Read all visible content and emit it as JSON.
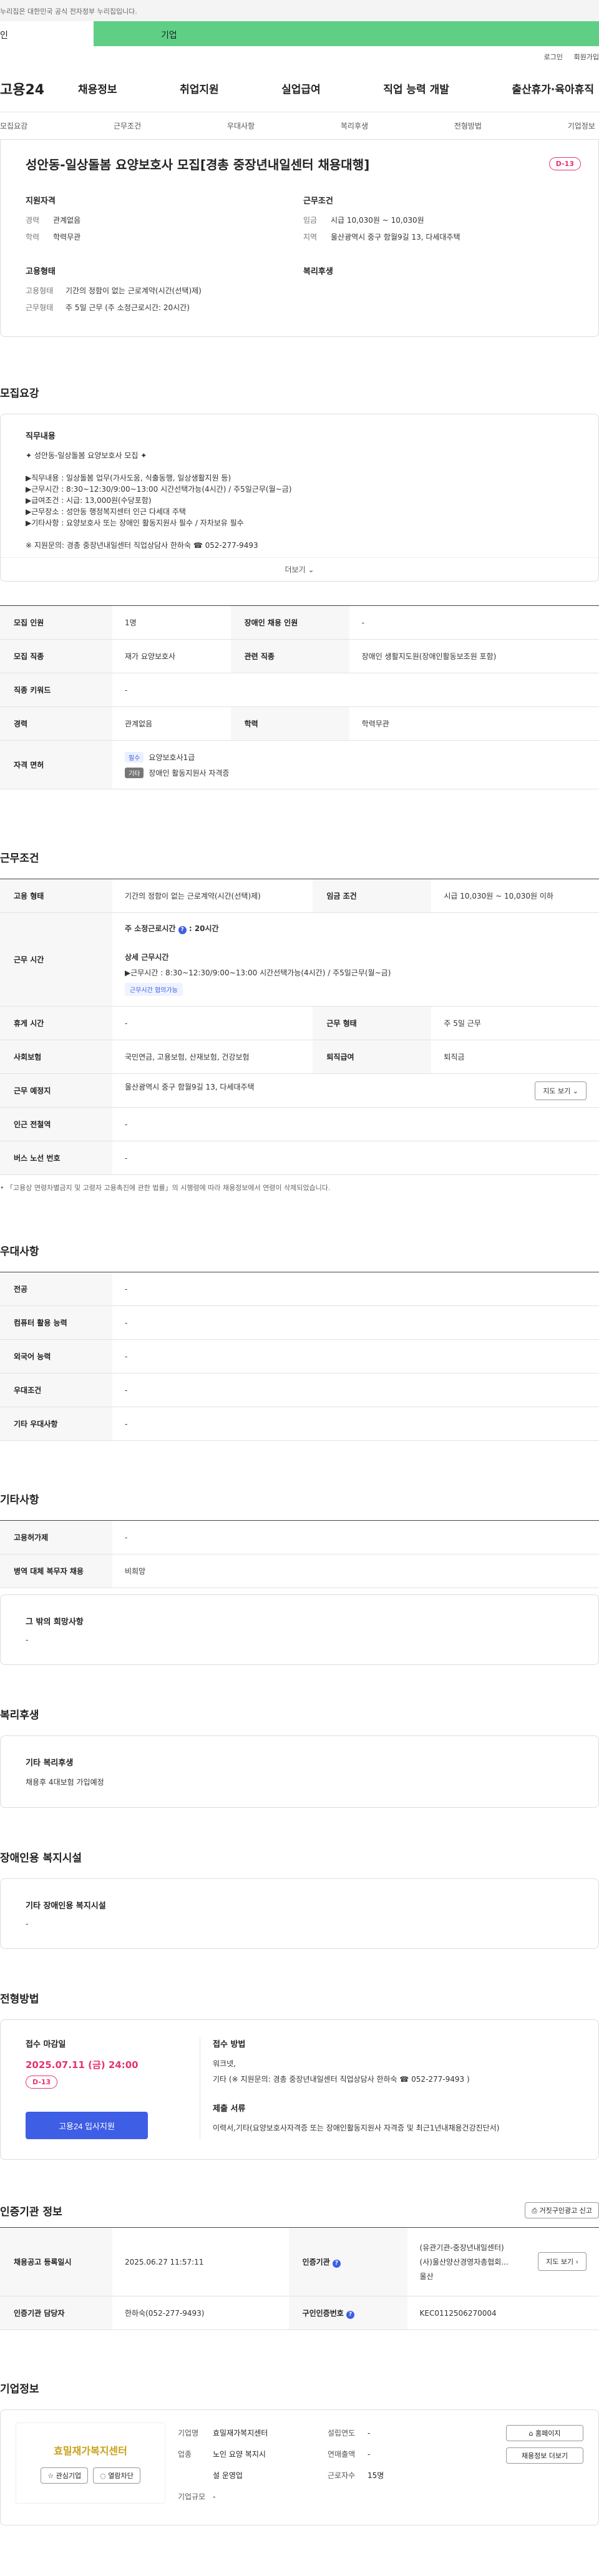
{
  "gov_notice": "누리집은 대한민국 공식 전자정부 누리집입니다.",
  "tabs": {
    "personal": "인",
    "business": "기업"
  },
  "utility": {
    "login": "로그인",
    "join": "회원가입"
  },
  "gnb": {
    "logo": "고용24",
    "menu": [
      "채용정보",
      "취업지원",
      "실업급여",
      "직업 능력 개발",
      "출산휴가·육아휴직"
    ]
  },
  "anchors": [
    "모집요강",
    "근무조건",
    "우대사항",
    "복리후생",
    "전형방법",
    "기업정보"
  ],
  "summary": {
    "title": "성안동-일상돌봄 요양보호사 모집[경총 중장년내일센터 채용대행]",
    "dday": "D-13",
    "qual": {
      "heading": "지원자격",
      "career_k": "경력",
      "career_v": "관계없음",
      "edu_k": "학력",
      "edu_v": "학력무관"
    },
    "cond": {
      "heading": "근무조건",
      "wage_k": "임금",
      "wage_v": "시급 10,030원 ~ 10,030원",
      "area_k": "지역",
      "area_v": "울산광역시 중구 함월9길 13, 다세대주택"
    },
    "emp": {
      "heading": "고용형태",
      "type_k": "고용형태",
      "type_v": "기간의 정함이 없는 근로계약(시간(선택)제)",
      "work_k": "근무형태",
      "work_v": "주 5일 근무 (주 소정근로시간: 20시간)"
    },
    "welfare": {
      "heading": "복리후생"
    }
  },
  "recruit": {
    "section_title": "모집요강",
    "desc_heading": "직무내용",
    "desc_lines": [
      "✦ 성안동-일상돌봄 요양보호사 모집 ✦",
      "",
      "▶직무내용 : 일상돌봄 업무(가사도움, 식출동행, 일상생활지원 등)",
      "▶근무시간 : 8:30~12:30/9:00~13:00 시간선택가능(4시간) / 주5일근무(월~금)",
      "▶급여조건 : 시급: 13,000원(수당포함)",
      "▶근무장소 : 성안동 행정복지센터 인근 다세대 주택",
      "▶기타사항 : 요양보호사 또는 장애인 활동지원사 필수 / 자차보유 필수",
      "",
      "※ 지원문의: 경총 중장년내일센터 직업상담사 한하숙 ☎ 052-277-9493"
    ],
    "more": "더보기",
    "rows": {
      "count_k": "모집 인원",
      "count_v": "1명",
      "disabled_k": "장애인 채용 인원",
      "disabled_v": "-",
      "job_k": "모집 직종",
      "job_v": "재가 요양보호사",
      "rel_k": "관련 직종",
      "rel_v": "장애인 생활지도원(장애인활동보조원 포함)",
      "kw_k": "직종 키워드",
      "kw_v": "-",
      "career_k": "경력",
      "career_v": "관계없음",
      "edu_k": "학력",
      "edu_v": "학력무관",
      "cert_k": "자격 면허",
      "cert1_tag": "필수",
      "cert1": "요양보호사1급",
      "cert2_tag": "기타",
      "cert2": "장애인 활동지원사 자격증"
    }
  },
  "work": {
    "section_title": "근무조건",
    "emp_k": "고용 형태",
    "emp_v": "기간의 정함이 없는 근로계약(시간(선택)제)",
    "wage_k": "임금 조건",
    "wage_v": "시급 10,030원 ~ 10,030원 이하",
    "time_k": "근무 시간",
    "week_hours_label": "주 소정근로시간",
    "week_hours": ": 20시간",
    "detail_label": "상세 근무시간",
    "detail_v": "▶근무시간 : 8:30~12:30/9:00~13:00 시간선택가능(4시간) / 주5일근무(월~금)",
    "flex_tag": "근무시간 협의가능",
    "break_k": "휴게 시간",
    "break_v": "-",
    "form_k": "근무 형태",
    "form_v": "주 5일 근무",
    "ins_k": "사회보험",
    "ins_v": "국민연금, 고용보험, 산재보험, 건강보험",
    "retire_k": "퇴직급여",
    "retire_v": "퇴직금",
    "place_k": "근무 예정지",
    "place_v": "울산광역시 중구 함월9길 13, 다세대주택",
    "map_btn": "지도 보기",
    "subway_k": "인근 전철역",
    "subway_v": "-",
    "bus_k": "버스 노선 번호",
    "bus_v": "-",
    "note": "「고용상 연령차별금지 및 고령자 고용촉진에 관한 법률」의 시행령에 따라 채용정보에서 연령이 삭제되었습니다."
  },
  "pref": {
    "section_title": "우대사항",
    "major_k": "전공",
    "major_v": "-",
    "pc_k": "컴퓨터 활용 능력",
    "pc_v": "-",
    "lang_k": "외국어 능력",
    "lang_v": "-",
    "cond_k": "우대조건",
    "cond_v": "-",
    "etc_k": "기타 우대사항",
    "etc_v": "-"
  },
  "etc": {
    "section_title": "기타사항",
    "permit_k": "고용허가제",
    "permit_v": "-",
    "military_k": "병역 대체 복무자 채용",
    "military_v": "비희망",
    "other_h": "그 밖의 희망사항",
    "other_v": "-"
  },
  "welfare": {
    "section_title": "복리후생",
    "h": "기타 복리후생",
    "v": "채용후 4대보험 가입예정"
  },
  "facility": {
    "section_title": "장애인용 복지시설",
    "h": "기타 장애인용 복지시설",
    "v": "-"
  },
  "selection": {
    "section_title": "전형방법",
    "deadline_label": "접수 마감일",
    "deadline": "2025.07.11 (금) 24:00",
    "dday": "D-13",
    "apply_btn": "고용24 입사지원",
    "method_h": "접수 방법",
    "method_v1": "워크넷,",
    "method_v2": "기타 (※ 지원문의: 경총 중장년내일센터 직업상담사 한하숙 ☎ 052-277-9493 )",
    "docs_h": "제출 서류",
    "docs_v": "이력서,기타(요양보호사자격증 또는 장애인활동지원사 자격증 및 최근1년내채용건강진단서)"
  },
  "cert": {
    "section_title": "인증기관 정보",
    "report_btn": "거짓구인광고 신고",
    "reg_k": "채용공고 등록일시",
    "reg_v": "2025.06.27 11:57:11",
    "org_k": "인증기관",
    "org_v1": "(유관기관-중장년내일센터)",
    "org_v2": "(사)울산양산경영자총협회...",
    "org_v3": "울산",
    "map_btn": "지도 보기",
    "mgr_k": "인증기관 담당자",
    "mgr_v": "한하숙(052-277-9493)",
    "num_k": "구인인증번호",
    "num_v": "KEC0112506270004"
  },
  "company": {
    "section_title": "기업정보",
    "logo_text": "효밀재가복지센터",
    "fav_btn": "관심기업",
    "review_btn": "열람차단",
    "name_k": "기업명",
    "name_v": "효밀재가복지센터",
    "ind_k": "업종",
    "ind_v1": "노인 요양 복지시",
    "ind_v2": "설 운영업",
    "size_k": "기업규모",
    "size_v": "-",
    "year_k": "설립연도",
    "year_v": "-",
    "sales_k": "연매출액",
    "sales_v": "-",
    "emp_k": "근로자수",
    "emp_v": "15명",
    "home_btn": "홈페이지",
    "list_btn": "채용정보 더보기"
  },
  "colors": {
    "accent_green": "#5ecf85",
    "primary_blue": "#3e5ee6",
    "dday_pink": "#e6336e"
  }
}
